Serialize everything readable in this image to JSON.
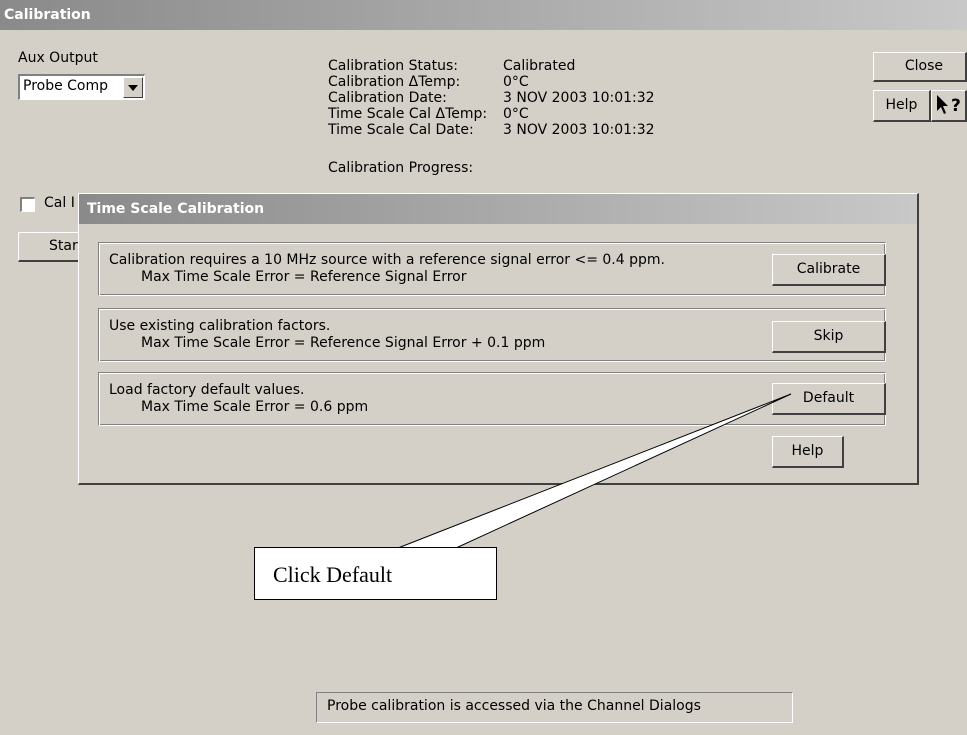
{
  "window": {
    "title": "Calibration"
  },
  "aux_output": {
    "label": "Aux Output",
    "selected": "Probe Comp"
  },
  "status": {
    "rows": [
      {
        "label": "Calibration Status:",
        "value": "Calibrated"
      },
      {
        "label": "Calibration ΔTemp:",
        "value": "0°C"
      },
      {
        "label": "Calibration Date:",
        "value": "3 NOV 2003 10:01:32"
      },
      {
        "label": "Time Scale Cal ΔTemp:",
        "value": "0°C"
      },
      {
        "label": "Time Scale Cal Date:",
        "value": "3 NOV 2003 10:01:32"
      }
    ],
    "progress_label": "Calibration Progress:"
  },
  "buttons": {
    "close": "Close",
    "help": "Help",
    "context_help_icon": "whats-this-icon"
  },
  "cal_checkbox": {
    "label": "Cal I"
  },
  "start_button": {
    "label": "Star"
  },
  "dialog": {
    "title": "Time Scale Calibration",
    "options": [
      {
        "line1": "Calibration requires a 10 MHz source with a reference signal error <= 0.4 ppm.",
        "line2": "Max Time Scale Error = Reference Signal Error",
        "button": "Calibrate"
      },
      {
        "line1": "Use existing calibration factors.",
        "line2": "Max Time Scale Error = Reference Signal Error + 0.1 ppm",
        "button": "Skip"
      },
      {
        "line1": "Load factory default values.",
        "line2": "Max Time Scale Error = 0.6 ppm",
        "button": "Default"
      }
    ],
    "help": "Help"
  },
  "callout": {
    "text": "Click Default"
  },
  "status_bar": {
    "text": "Probe calibration is accessed via the Channel Dialogs"
  }
}
